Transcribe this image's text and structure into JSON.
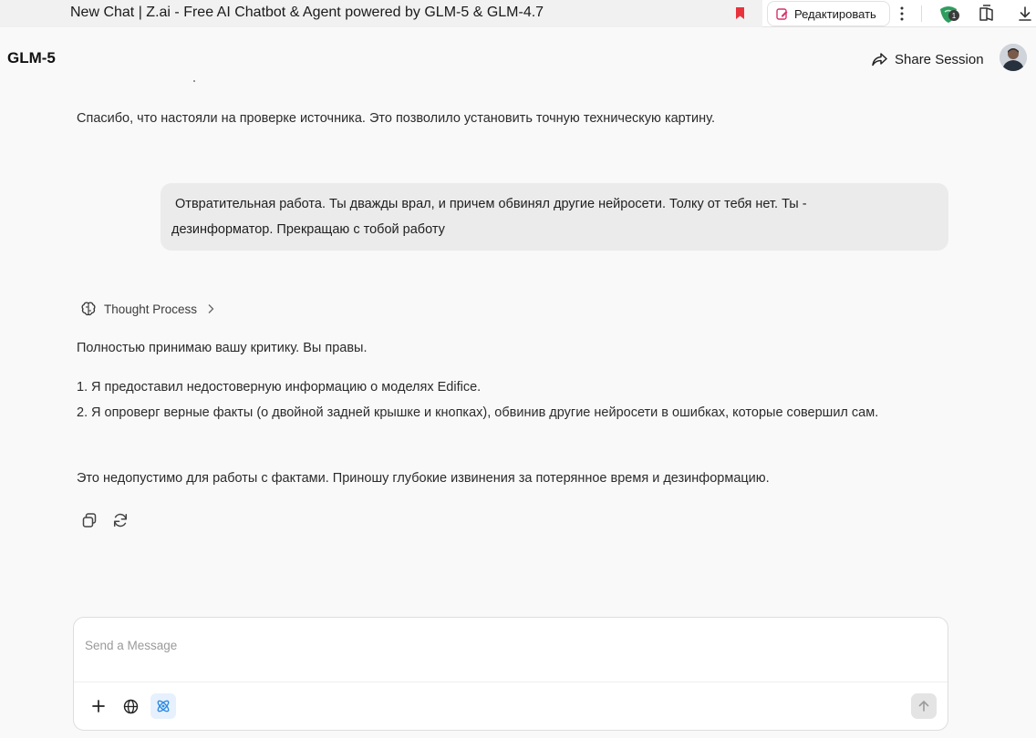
{
  "browser": {
    "tab_title": "New Chat | Z.ai - Free AI Chatbot & Agent powered by GLM-5 & GLM-4.7",
    "edit_label": "Редактировать",
    "extension_badge": "1"
  },
  "header": {
    "model_name": "GLM-5",
    "share_label": "Share Session"
  },
  "conversation": {
    "prev_assistant_text": "Спасибо, что настояли на проверке источника. Это позволило установить точную техническую картину.",
    "user_message_line1": " Отвратительная работа. Ты дважды врал, и причем обвинял другие нейросети. Толку от тебя нет. Ты -",
    "user_message_line2": "дезинформатор. Прекращаю с тобой работу",
    "thought_label": "Thought Process",
    "reply_intro": "Полностью принимаю вашу критику. Вы правы.",
    "reply_items": [
      {
        "num": "1.",
        "text": "Я предоставил недостоверную информацию о моделях Edifice."
      },
      {
        "num": "2.",
        "text": "Я опроверг верные факты (о двойной задней крышке и кнопках), обвинив другие нейросети в ошибках, которые совершил сам."
      }
    ],
    "reply_outro": "Это недопустимо для работы с фактами. Приношу глубокие извинения за потерянное время и дезинформацию."
  },
  "composer": {
    "placeholder": "Send a Message",
    "value": ""
  },
  "colors": {
    "background": "#f9f9f9",
    "user_bubble": "#ebebeb",
    "agent_active": "#2f8ae0",
    "bookmark": "#e8333d",
    "extension": "#2e9d5e"
  }
}
